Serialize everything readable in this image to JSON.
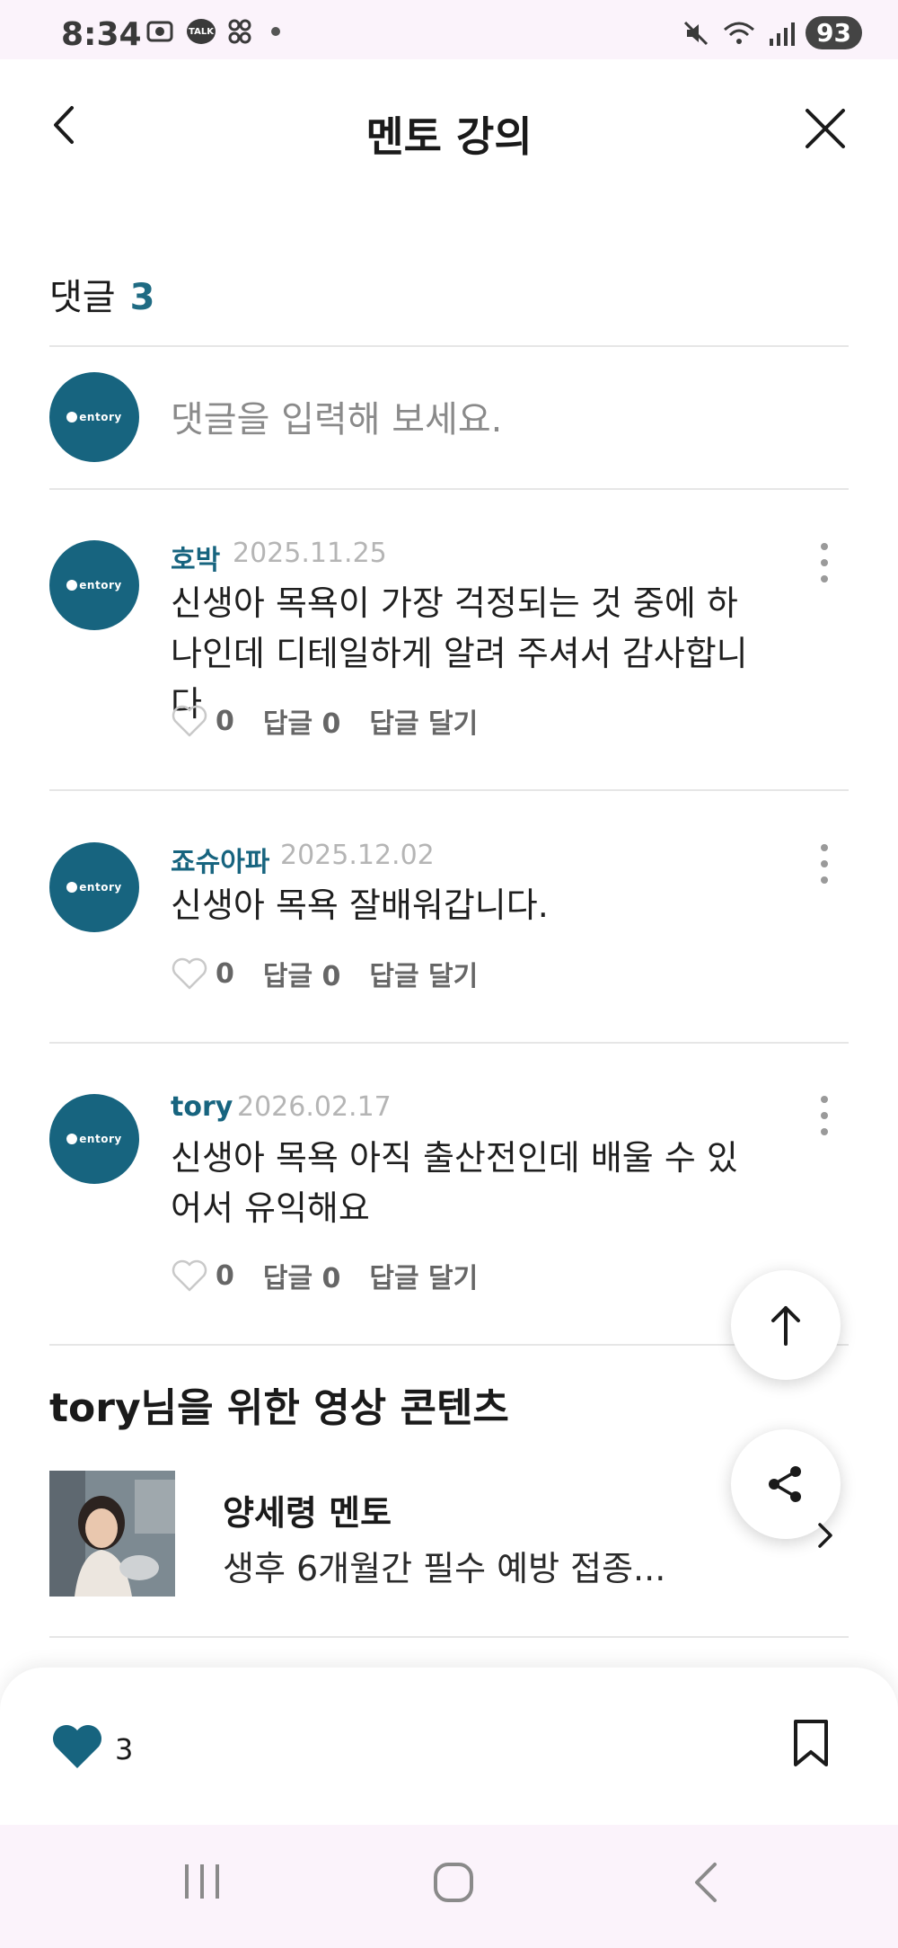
{
  "status_bar": {
    "time": "8:34",
    "talk_badge": "TALK",
    "battery": "93"
  },
  "header": {
    "title": "멘토 강의"
  },
  "comments": {
    "label": "댓글",
    "count": "3",
    "input_placeholder": "댓글을 입력해 보세요.",
    "avatar_text": "entory",
    "reply_count_label": "답글 0",
    "reply_action_label": "답글 달기",
    "items": [
      {
        "author": "호박",
        "date": "2025.11.25",
        "text": "신생아 목욕이 가장 걱정되는 것 중에 하나인데 디테일하게 알려 주셔서 감사합니다",
        "likes": "0"
      },
      {
        "author": "죠슈아파",
        "date": "2025.12.02",
        "text": "신생아 목욕 잘배워갑니다.",
        "likes": "0"
      },
      {
        "author": "tory",
        "date": "2026.02.17",
        "text": "신생아 목욕 아직 출산전인데 배울 수 있어서 유익해요",
        "likes": "0"
      }
    ]
  },
  "recommended": {
    "title": "tory님을 위한 영상 콘텐츠",
    "mentor": "양세령 멘토",
    "description": "생후 6개월간 필수 예방 접종..."
  },
  "bottom_bar": {
    "like_count": "3"
  },
  "colors": {
    "accent": "#17647f",
    "status_bg": "#fbf3fb"
  }
}
